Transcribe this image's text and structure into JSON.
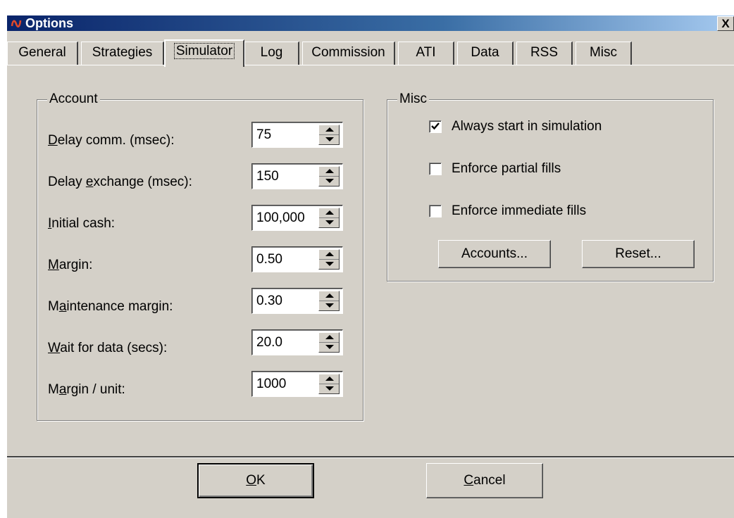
{
  "window": {
    "title": "Options",
    "close_glyph": "X",
    "colors": {
      "face": "#d4d0c8",
      "title_start": "#0a246a",
      "title_end": "#a6caf0"
    }
  },
  "tabs": [
    "General",
    "Strategies",
    "Simulator",
    "Log",
    "Commission",
    "ATI",
    "Data",
    "RSS",
    "Misc"
  ],
  "active_tab": "Simulator",
  "account": {
    "group_label": "Account",
    "fields": [
      {
        "pre": "",
        "mn": "D",
        "post": "elay comm. (msec):",
        "value": "75"
      },
      {
        "pre": "Delay ",
        "mn": "e",
        "post": "xchange (msec):",
        "value": "150"
      },
      {
        "pre": "",
        "mn": "I",
        "post": "nitial cash:",
        "value": "100,000"
      },
      {
        "pre": "",
        "mn": "M",
        "post": "argin:",
        "value": "0.50"
      },
      {
        "pre": "M",
        "mn": "a",
        "post": "intenance margin:",
        "value": "0.30"
      },
      {
        "pre": "",
        "mn": "W",
        "post": "ait for data (secs):",
        "value": "20.0"
      },
      {
        "pre": "M",
        "mn": "a",
        "post": "rgin / unit:",
        "value": "1000"
      }
    ]
  },
  "misc": {
    "group_label": "Misc",
    "options": [
      {
        "label": "Always start in simulation",
        "checked": true
      },
      {
        "label": "Enforce partial fills",
        "checked": false
      },
      {
        "label": "Enforce immediate fills",
        "checked": false
      }
    ],
    "accounts_button": "Accounts...",
    "reset_button": "Reset..."
  },
  "footer": {
    "ok": {
      "mn": "O",
      "post": "K"
    },
    "cancel": {
      "mn": "C",
      "post": "ancel"
    }
  }
}
